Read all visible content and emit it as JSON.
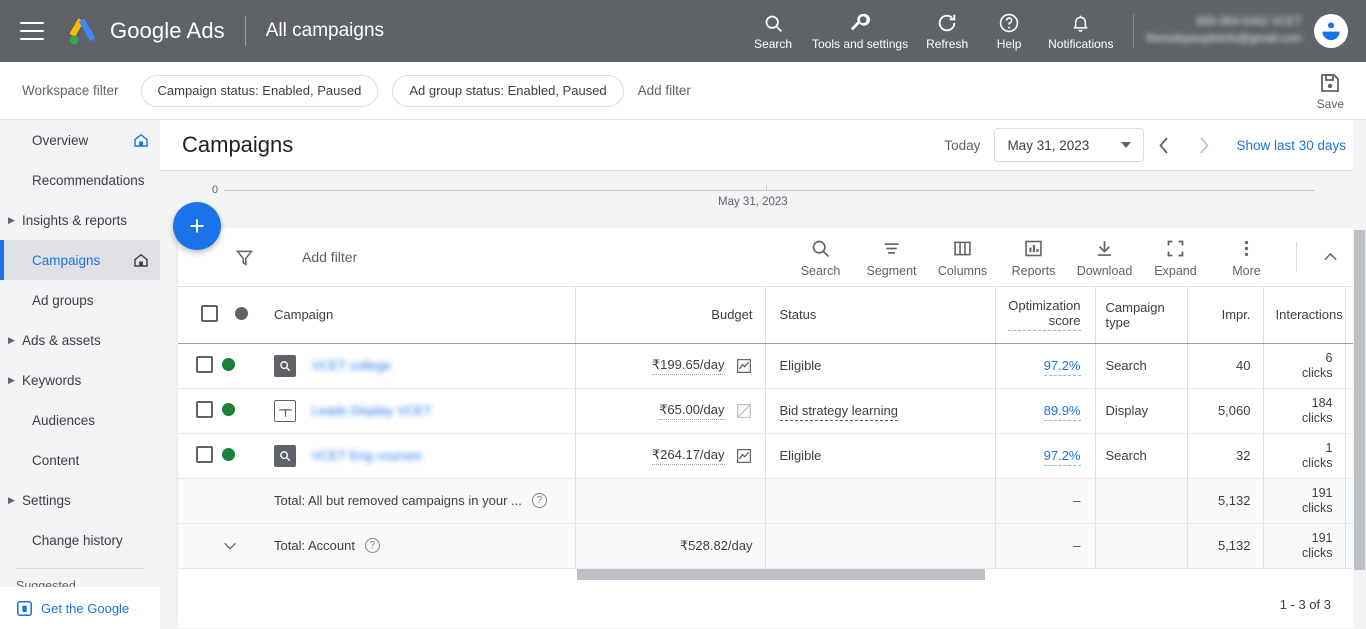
{
  "topbar": {
    "menu_icon": "hamburger-menu-icon",
    "logo_icon": "google-ads-logo-icon",
    "brand": "Google Ads",
    "context": "All campaigns",
    "actions": [
      {
        "label": "Search",
        "icon": "search-icon"
      },
      {
        "label": "Tools and settings",
        "icon": "wrench-icon"
      },
      {
        "label": "Refresh",
        "icon": "refresh-icon"
      },
      {
        "label": "Help",
        "icon": "help-circle-icon"
      },
      {
        "label": "Notifications",
        "icon": "bell-icon"
      }
    ],
    "account": {
      "id_line": "655-064-5442 VCET",
      "email_line": "theredspeopleinfo@gmail.com",
      "avatar_icon": "account-avatar-icon"
    }
  },
  "filterbar": {
    "workspace_label": "Workspace filter",
    "chips": [
      "Campaign status: Enabled, Paused",
      "Ad group status: Enabled, Paused"
    ],
    "add_filter": "Add filter",
    "save": {
      "label": "Save",
      "icon": "save-disk-icon"
    }
  },
  "sidebar": {
    "items": [
      {
        "label": "Overview",
        "icon": "home-pin-icon",
        "expandable": false,
        "active": false,
        "home": true
      },
      {
        "label": "Recommendations",
        "icon": "",
        "expandable": false,
        "active": false,
        "home": false
      },
      {
        "label": "Insights & reports",
        "icon": "",
        "expandable": true,
        "active": false,
        "home": false
      },
      {
        "label": "Campaigns",
        "icon": "home-pin-icon",
        "expandable": false,
        "active": true,
        "home": true
      },
      {
        "label": "Ad groups",
        "icon": "",
        "expandable": false,
        "active": false,
        "home": false
      },
      {
        "label": "Ads & assets",
        "icon": "",
        "expandable": true,
        "active": false,
        "home": false
      },
      {
        "label": "Keywords",
        "icon": "",
        "expandable": true,
        "active": false,
        "home": false
      },
      {
        "label": "Audiences",
        "icon": "",
        "expandable": false,
        "active": false,
        "home": false
      },
      {
        "label": "Content",
        "icon": "",
        "expandable": false,
        "active": false,
        "home": false
      },
      {
        "label": "Settings",
        "icon": "",
        "expandable": true,
        "active": false,
        "home": false
      },
      {
        "label": "Change history",
        "icon": "",
        "expandable": false,
        "active": false,
        "home": false
      }
    ],
    "suggested_label": "Suggested",
    "promo": {
      "label": "Get the Google",
      "icon": "google-app-icon"
    }
  },
  "page": {
    "title": "Campaigns",
    "today_label": "Today",
    "date_value": "May 31, 2023",
    "prev_icon": "chevron-left-icon",
    "next_icon": "chevron-right-icon",
    "show_last_30": "Show last 30 days"
  },
  "chart_data": {
    "type": "line",
    "title": "",
    "x": [
      "May 31, 2023"
    ],
    "values": [
      0
    ],
    "ylabel": "",
    "xlabel": "",
    "ytick_labels": [
      "0"
    ],
    "xtick_labels": [
      "May 31, 2023"
    ],
    "ylim": [
      0,
      0
    ],
    "grid": false,
    "legend": "none"
  },
  "fab": {
    "label": "+",
    "icon": "add-campaign-icon"
  },
  "toolbar": {
    "filter_icon": "filter-funnel-icon",
    "add_filter": "Add filter",
    "buttons": [
      {
        "label": "Search",
        "icon": "search-icon"
      },
      {
        "label": "Segment",
        "icon": "segment-icon"
      },
      {
        "label": "Columns",
        "icon": "columns-icon"
      },
      {
        "label": "Reports",
        "icon": "reports-bar-chart-icon"
      },
      {
        "label": "Download",
        "icon": "download-icon"
      },
      {
        "label": "Expand",
        "icon": "expand-icon"
      },
      {
        "label": "More",
        "icon": "more-vertical-icon"
      }
    ],
    "collapse_icon": "chevron-up-icon"
  },
  "table": {
    "headers": {
      "campaign": "Campaign",
      "budget": "Budget",
      "status": "Status",
      "optimization_score": "Optimization score",
      "campaign_type": "Campaign type",
      "impr": "Impr.",
      "interactions": "Interactions"
    },
    "rows": [
      {
        "name": "VCET college",
        "type_icon": "search-campaign-icon",
        "status_dot": "enabled",
        "budget": "₹199.65/day",
        "budget_chart_icon": "sparkline-icon",
        "budget_chart_active": true,
        "status": "Eligible",
        "status_dashed": false,
        "optimization_score": "97.2%",
        "campaign_type": "Search",
        "impr": "40",
        "interactions": "6",
        "interactions_unit": "clicks"
      },
      {
        "name": "Leads Display VCET",
        "type_icon": "display-campaign-icon",
        "status_dot": "enabled",
        "budget": "₹65.00/day",
        "budget_chart_icon": "sparkline-disabled-icon",
        "budget_chart_active": false,
        "status": "Bid strategy learning",
        "status_dashed": true,
        "optimization_score": "89.9%",
        "campaign_type": "Display",
        "impr": "5,060",
        "interactions": "184",
        "interactions_unit": "clicks"
      },
      {
        "name": "VCET Eng courses",
        "type_icon": "search-campaign-icon",
        "status_dot": "enabled",
        "budget": "₹264.17/day",
        "budget_chart_icon": "sparkline-icon",
        "budget_chart_active": true,
        "status": "Eligible",
        "status_dashed": false,
        "optimization_score": "97.2%",
        "campaign_type": "Search",
        "impr": "32",
        "interactions": "1",
        "interactions_unit": "clicks"
      }
    ],
    "totals": [
      {
        "label": "Total: All but removed campaigns in your ...",
        "has_chevron": false,
        "budget": "",
        "status": "",
        "optimization_score": "–",
        "campaign_type": "",
        "impr": "5,132",
        "interactions": "191",
        "interactions_unit": "clicks"
      },
      {
        "label": "Total: Account",
        "has_chevron": true,
        "budget": "₹528.82/day",
        "status": "",
        "optimization_score": "–",
        "campaign_type": "",
        "impr": "5,132",
        "interactions": "191",
        "interactions_unit": "clicks"
      }
    ],
    "pager": "1 - 3 of 3"
  }
}
